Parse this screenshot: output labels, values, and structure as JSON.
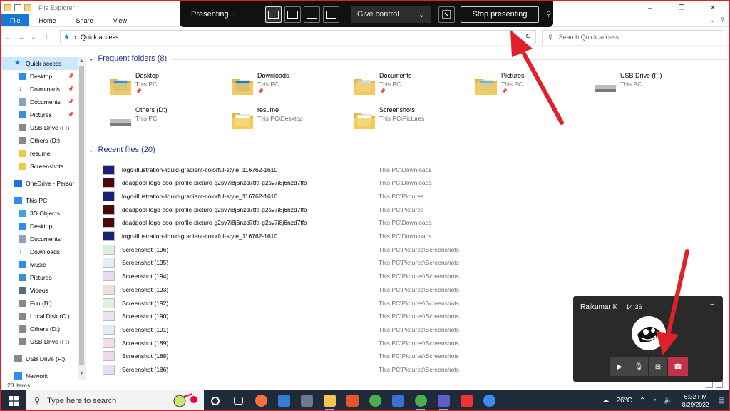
{
  "window": {
    "title": "File Explorer",
    "controls": [
      "–",
      "❐",
      "✕"
    ]
  },
  "ribbon": {
    "tabs": [
      "File",
      "Home",
      "Share",
      "View"
    ]
  },
  "address": {
    "path": "Quick access",
    "search_placeholder": "Search Quick access"
  },
  "presenting_bar": {
    "label": "Presenting...",
    "give_control": "Give control",
    "stop": "Stop presenting"
  },
  "sidebar": {
    "items": [
      {
        "label": "Quick access",
        "icon": "star-icon",
        "pinned": false,
        "selected": true,
        "level": "top",
        "color": "#1976d2"
      },
      {
        "label": "Desktop",
        "icon": "desktop-folder-icon",
        "pinned": true,
        "level": "sub",
        "color": "#2f8ee8"
      },
      {
        "label": "Downloads",
        "icon": "download-arrow-icon",
        "pinned": true,
        "level": "sub",
        "color": "#1976d2"
      },
      {
        "label": "Documents",
        "icon": "documents-icon",
        "pinned": true,
        "level": "sub",
        "color": "#8aa4bd"
      },
      {
        "label": "Pictures",
        "icon": "pictures-icon",
        "pinned": true,
        "level": "sub",
        "color": "#3b8fd6"
      },
      {
        "label": "USB Drive (F:)",
        "icon": "drive-icon",
        "pinned": false,
        "level": "sub",
        "color": "#888888"
      },
      {
        "label": "Others (D:)",
        "icon": "drive-icon",
        "pinned": false,
        "level": "sub",
        "color": "#888888"
      },
      {
        "label": "resume",
        "icon": "folder-icon",
        "pinned": false,
        "level": "sub",
        "color": "#f3c553"
      },
      {
        "label": "Screenshots",
        "icon": "folder-icon",
        "pinned": false,
        "level": "sub",
        "color": "#f3c553"
      },
      {
        "label": "OneDrive - Persor",
        "icon": "cloud-icon",
        "pinned": false,
        "level": "top",
        "color": "#1976d2"
      },
      {
        "label": "This PC",
        "icon": "computer-icon",
        "pinned": false,
        "level": "top",
        "color": "#2f8ee8"
      },
      {
        "label": "3D Objects",
        "icon": "cube-icon",
        "pinned": false,
        "level": "sub",
        "color": "#3fa3e8"
      },
      {
        "label": "Desktop",
        "icon": "desktop-folder-icon",
        "pinned": false,
        "level": "sub",
        "color": "#2f8ee8"
      },
      {
        "label": "Documents",
        "icon": "documents-icon",
        "pinned": false,
        "level": "sub",
        "color": "#8aa4bd"
      },
      {
        "label": "Downloads",
        "icon": "download-arrow-icon",
        "pinned": false,
        "level": "sub",
        "color": "#1976d2"
      },
      {
        "label": "Music",
        "icon": "music-icon",
        "pinned": false,
        "level": "sub",
        "color": "#2f8ee8"
      },
      {
        "label": "Pictures",
        "icon": "pictures-icon",
        "pinned": false,
        "level": "sub",
        "color": "#3b8fd6"
      },
      {
        "label": "Videos",
        "icon": "videos-icon",
        "pinned": false,
        "level": "sub",
        "color": "#5a6b7c"
      },
      {
        "label": "Fun (B:)",
        "icon": "drive-icon",
        "pinned": false,
        "level": "sub",
        "color": "#888888"
      },
      {
        "label": "Local Disk (C:)",
        "icon": "windows-drive-icon",
        "pinned": false,
        "level": "sub",
        "color": "#888888"
      },
      {
        "label": "Others (D:)",
        "icon": "drive-icon",
        "pinned": false,
        "level": "sub",
        "color": "#888888"
      },
      {
        "label": "USB Drive (F:)",
        "icon": "drive-icon",
        "pinned": false,
        "level": "sub",
        "color": "#888888"
      },
      {
        "label": "USB Drive (F:)",
        "icon": "drive-icon",
        "pinned": false,
        "level": "top",
        "color": "#888888"
      },
      {
        "label": "Network",
        "icon": "network-icon",
        "pinned": false,
        "level": "top",
        "color": "#2f8ee8"
      }
    ]
  },
  "frequent": {
    "header": "Frequent folders (8)",
    "folders": [
      {
        "name": "Desktop",
        "location": "This PC",
        "pinned": true,
        "kind": "desktop"
      },
      {
        "name": "Downloads",
        "location": "This PC",
        "pinned": true,
        "kind": "downloads"
      },
      {
        "name": "Documents",
        "location": "This PC",
        "pinned": true,
        "kind": "documents"
      },
      {
        "name": "Pictures",
        "location": "This PC",
        "pinned": true,
        "kind": "pictures"
      },
      {
        "name": "USB Drive (F:)",
        "location": "This PC",
        "pinned": false,
        "kind": "drive"
      },
      {
        "name": "Others (D:)",
        "location": "This PC",
        "pinned": false,
        "kind": "drive"
      },
      {
        "name": "resume",
        "location": "This PC\\Desktop",
        "pinned": false,
        "kind": "folder"
      },
      {
        "name": "Screenshots",
        "location": "This PC\\Pictures",
        "pinned": false,
        "kind": "folder"
      }
    ]
  },
  "recent": {
    "header": "Recent files (20)",
    "files": [
      {
        "name": "logo-illustration-liquid-gradient-colorful-style_116762-1610",
        "path": "This PC\\Downloads",
        "thumb": "#1b1f7a"
      },
      {
        "name": "deadpool-logo-cool-profile-picture-g2sv7i8j6nzd7tfa-g2sv7i8j6nzd7tfa",
        "path": "This PC\\Downloads",
        "thumb": "#4a0a0a"
      },
      {
        "name": "logo-illustration-liquid-gradient-colorful-style_116762-1610",
        "path": "This PC\\Pictures",
        "thumb": "#1b1f7a"
      },
      {
        "name": "deadpool-logo-cool-profile-picture-g2sv7i8j6nzd7tfa-g2sv7i8j6nzd7tfa",
        "path": "This PC\\Pictures",
        "thumb": "#4a0a0a"
      },
      {
        "name": "deadpool-logo-cool-profile-picture-g2sv7i8j6nzd7tfa-g2sv7i8j6nzd7tfa",
        "path": "This PC\\Downloads",
        "thumb": "#4a0a0a"
      },
      {
        "name": "logo-illustration-liquid-gradient-colorful-style_116762-1610",
        "path": "This PC\\Downloads",
        "thumb": "#1b1f7a"
      },
      {
        "name": "Screenshot (196)",
        "path": "This PC\\Pictures\\Screenshots",
        "thumb": "#d7f0dc"
      },
      {
        "name": "Screenshot (195)",
        "path": "This PC\\Pictures\\Screenshots",
        "thumb": "#e0eef7"
      },
      {
        "name": "Screenshot (194)",
        "path": "This PC\\Pictures\\Screenshots",
        "thumb": "#efd9ee"
      },
      {
        "name": "Screenshot (193)",
        "path": "This PC\\Pictures\\Screenshots",
        "thumb": "#f3dcdc"
      },
      {
        "name": "Screenshot (192)",
        "path": "This PC\\Pictures\\Screenshots",
        "thumb": "#dff0de"
      },
      {
        "name": "Screenshot (190)",
        "path": "This PC\\Pictures\\Screenshots",
        "thumb": "#e9e2f3"
      },
      {
        "name": "Screenshot (191)",
        "path": "This PC\\Pictures\\Screenshots",
        "thumb": "#dbeef7"
      },
      {
        "name": "Screenshot (189)",
        "path": "This PC\\Pictures\\Screenshots",
        "thumb": "#f1e0e0"
      },
      {
        "name": "Screenshot (188)",
        "path": "This PC\\Pictures\\Screenshots",
        "thumb": "#ecd8ef"
      },
      {
        "name": "Screenshot (186)",
        "path": "This PC\\Pictures\\Screenshots",
        "thumb": "#e6def3"
      }
    ]
  },
  "status": {
    "items": "28 items"
  },
  "call": {
    "name": "Rajkumar K",
    "time": "14:36"
  },
  "taskbar": {
    "search_placeholder": "Type here to search",
    "apps": [
      {
        "icon": "cortana-icon",
        "color": "#1f2b3a",
        "active": false
      },
      {
        "icon": "task-view-icon",
        "color": "#1f2b3a",
        "active": false
      },
      {
        "icon": "firefox-icon",
        "color": "#ff7139",
        "active": false
      },
      {
        "icon": "control-panel-icon",
        "color": "#3a7bd5",
        "active": false
      },
      {
        "icon": "calculator-icon",
        "color": "#6b7b8c",
        "active": false
      },
      {
        "icon": "file-explorer-icon",
        "color": "#f3c553",
        "active": true
      },
      {
        "icon": "office-icon",
        "color": "#e4572e",
        "active": false
      },
      {
        "icon": "chrome-icon",
        "color": "#4caf50",
        "active": false
      },
      {
        "icon": "app-badge-icon",
        "color": "#3d6fd8",
        "active": false
      },
      {
        "icon": "chrome-profile-icon",
        "color": "#4caf50",
        "active": true
      },
      {
        "icon": "teams-icon",
        "color": "#5b5fc7",
        "active": true
      },
      {
        "icon": "media-icon",
        "color": "#e33",
        "active": false
      },
      {
        "icon": "help-icon",
        "color": "#3a8ef0",
        "active": false
      }
    ],
    "weather": "26°C",
    "time": "6:32 PM",
    "date": "8/29/2022"
  }
}
